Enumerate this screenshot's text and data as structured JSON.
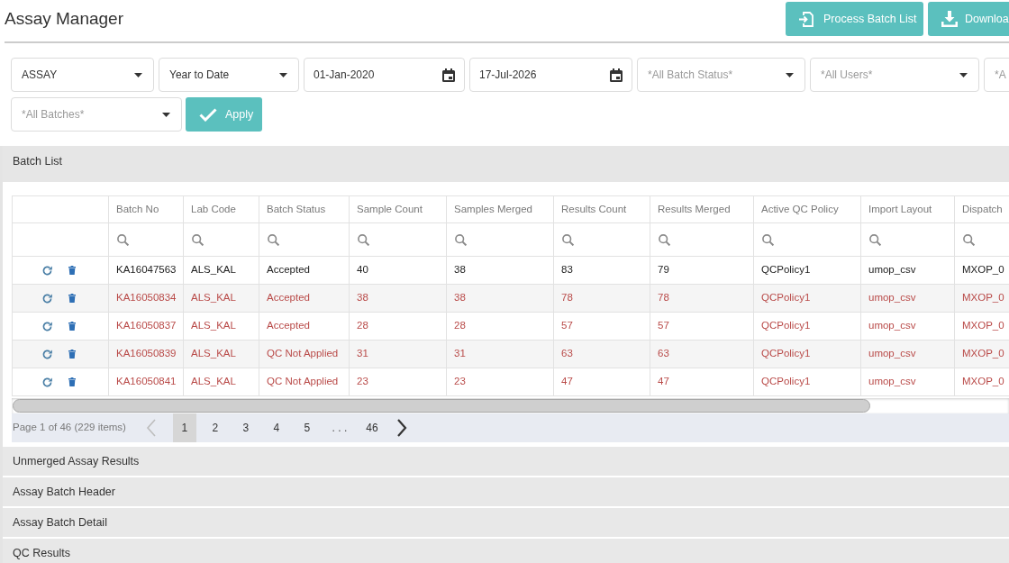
{
  "header": {
    "title": "Assay Manager",
    "buttons": [
      {
        "kind": "process",
        "label": "Process Batch List"
      },
      {
        "kind": "download",
        "label": "Downloa"
      }
    ]
  },
  "filter_rows": [
    [
      {
        "kind": "dropdown",
        "value": "ASSAY"
      },
      {
        "kind": "dropdown",
        "value": "Year to Date"
      },
      {
        "kind": "date",
        "value": "01-Jan-2020"
      },
      {
        "kind": "date",
        "value": "17-Jul-2026"
      },
      {
        "kind": "dropdown",
        "placeholder": "*All Batch Status*"
      },
      {
        "kind": "dropdown",
        "placeholder": "*All Users*"
      },
      {
        "kind": "dropdown",
        "placeholder": "*A"
      }
    ],
    [
      {
        "kind": "dropdown",
        "placeholder": "*All Batches*"
      }
    ]
  ],
  "apply_button": {
    "label": "Apply"
  },
  "batch_list": {
    "title": "Batch List",
    "table": {
      "columns": [
        "Batch No",
        "Lab Code",
        "Batch Status",
        "Sample Count",
        "Samples Merged",
        "Results Count",
        "Results Merged",
        "Active QC Policy",
        "Import Layout",
        "Dispatch"
      ],
      "rows": [
        {
          "color": "#222222",
          "cells": [
            "KA16047563",
            "ALS_KAL",
            "Accepted",
            "40",
            "38",
            "83",
            "79",
            "QCPolicy1",
            "umop_csv",
            "MXOP_0"
          ]
        },
        {
          "color": "#b94a48",
          "cells": [
            "KA16050834",
            "ALS_KAL",
            "Accepted",
            "38",
            "38",
            "78",
            "78",
            "QCPolicy1",
            "umop_csv",
            "MXOP_0"
          ]
        },
        {
          "color": "#b94a48",
          "cells": [
            "KA16050837",
            "ALS_KAL",
            "Accepted",
            "28",
            "28",
            "57",
            "57",
            "QCPolicy1",
            "umop_csv",
            "MXOP_0"
          ]
        },
        {
          "color": "#b94a48",
          "cells": [
            "KA16050839",
            "ALS_KAL",
            "QC Not Applied",
            "31",
            "31",
            "63",
            "63",
            "QCPolicy1",
            "umop_csv",
            "MXOP_0"
          ]
        },
        {
          "color": "#b94a48",
          "cells": [
            "KA16050841",
            "ALS_KAL",
            "QC Not Applied",
            "23",
            "23",
            "47",
            "47",
            "QCPolicy1",
            "umop_csv",
            "MXOP_0"
          ]
        }
      ]
    },
    "pager": {
      "info": "Page 1 of 46 (229 items)",
      "previous": {
        "disabled": true
      },
      "pages": [
        {
          "kind": "page",
          "label": "1",
          "selected": true
        },
        {
          "kind": "page",
          "label": "2",
          "selected": false
        },
        {
          "kind": "page",
          "label": "3",
          "selected": false
        },
        {
          "kind": "page",
          "label": "4",
          "selected": false
        },
        {
          "kind": "page",
          "label": "5",
          "selected": false
        },
        {
          "kind": "ellipsis",
          "label": ". . .",
          "selected": false
        },
        {
          "kind": "page",
          "label": "46",
          "selected": false
        }
      ],
      "next": {
        "disabled": false
      }
    }
  },
  "sections": [
    {
      "title": "Unmerged Assay Results"
    },
    {
      "title": "Assay Batch Header"
    },
    {
      "title": "Assay Batch Detail"
    },
    {
      "title": "QC Results"
    }
  ]
}
